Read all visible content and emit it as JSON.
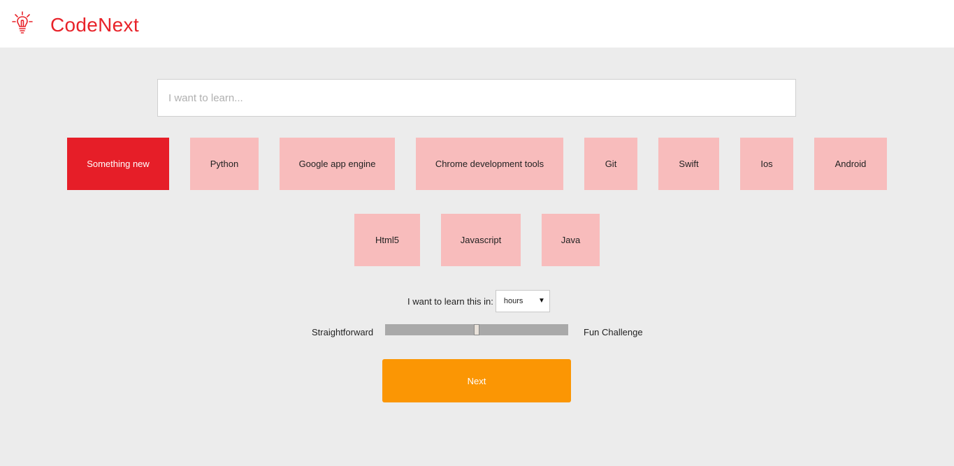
{
  "header": {
    "brand": "CodeNext",
    "logo_icon": "lightbulb-icon",
    "accent_color": "#e8232a"
  },
  "search": {
    "placeholder": "I want to learn...",
    "value": ""
  },
  "topics": {
    "row1": [
      {
        "label": "Something new",
        "selected": true
      },
      {
        "label": "Python",
        "selected": false
      },
      {
        "label": "Google app engine",
        "selected": false
      },
      {
        "label": "Chrome development tools",
        "selected": false
      },
      {
        "label": "Git",
        "selected": false
      },
      {
        "label": "Swift",
        "selected": false
      },
      {
        "label": "Ios",
        "selected": false
      },
      {
        "label": "Android",
        "selected": false
      }
    ],
    "row2": [
      {
        "label": "Html5",
        "selected": false
      },
      {
        "label": "Javascript",
        "selected": false
      },
      {
        "label": "Java",
        "selected": false
      }
    ],
    "selected_color": "#e61e28",
    "unselected_color": "#f8bcbc"
  },
  "duration": {
    "label": "I want to learn this in:",
    "selected": "hours",
    "arrow_icon": "dropdown-arrow-icon"
  },
  "difficulty": {
    "left_label": "Straightforward",
    "right_label": "Fun Challenge",
    "value_fraction": 0.5
  },
  "next_button": {
    "label": "Next",
    "color": "#fb9604"
  }
}
